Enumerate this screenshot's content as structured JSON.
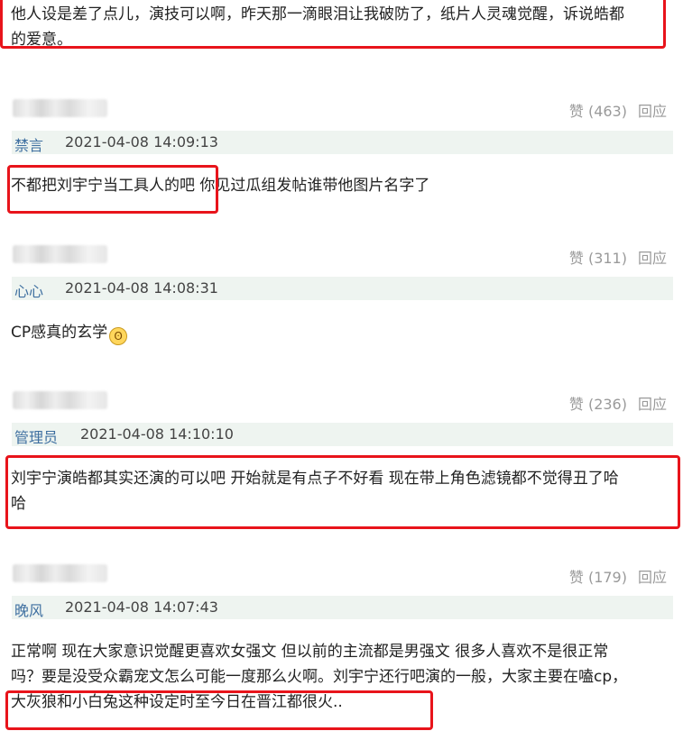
{
  "comments": [
    {
      "text_lines": [
        "他人设是差了点儿，演技可以啊，昨天那一滴眼泪让我破防了，纸片人灵魂觉醒，诉说皓都",
        "的爱意。"
      ]
    },
    {
      "likes": "赞 (463)",
      "reply": "回应",
      "user": "禁言",
      "time": "2021-04-08 14:09:13",
      "text": "不都把刘宇宁当工具人的吧 你见过瓜组发帖谁带他图片名字了"
    },
    {
      "likes": "赞 (311)",
      "reply": "回应",
      "user": "心心",
      "time": "2021-04-08 14:08:31",
      "text": "CP感真的玄学"
    },
    {
      "likes": "赞 (236)",
      "reply": "回应",
      "user": "管理员",
      "time": "2021-04-08 14:10:10",
      "text_lines": [
        "刘宇宁演皓都其实还演的可以吧 开始就是有点子不好看 现在带上角色滤镜都不觉得丑了哈",
        "哈"
      ]
    },
    {
      "likes": "赞 (179)",
      "reply": "回应",
      "user": "晚风",
      "time": "2021-04-08 14:07:43",
      "text_lines": [
        "正常啊 现在大家意识觉醒更喜欢女强文 但以前的主流都是男强文 很多人喜欢不是很正常",
        "吗？要是没受众霸宠文怎么可能一度那么火啊。刘宇宁还行吧演的一般，大家主要在嗑cp，",
        "大灰狼和小白兔这种设定时至今日在晋江都很火.."
      ]
    }
  ],
  "colors": {
    "highlight": "#e8141b",
    "username": "#3e6fa0",
    "meta_bg": "#eef4f0"
  },
  "icons": {
    "emoji": "grinning-sweat-emoji"
  }
}
